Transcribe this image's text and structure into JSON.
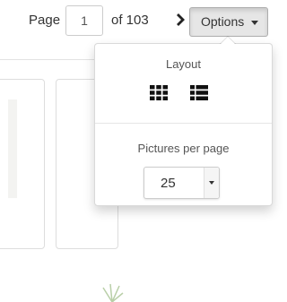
{
  "pagination": {
    "page_label": "Page",
    "current_page": "1",
    "of_text": "of 103"
  },
  "options_button": {
    "label": "Options"
  },
  "dropdown": {
    "layout_heading": "Layout",
    "layout_options": [
      "grid-view-icon",
      "list-view-icon"
    ],
    "pictures_per_page_heading": "Pictures per page",
    "pictures_per_page_value": "25"
  },
  "colors": {
    "button_bg": "#e6e6e6",
    "border": "#cccccc",
    "text": "#333333"
  }
}
